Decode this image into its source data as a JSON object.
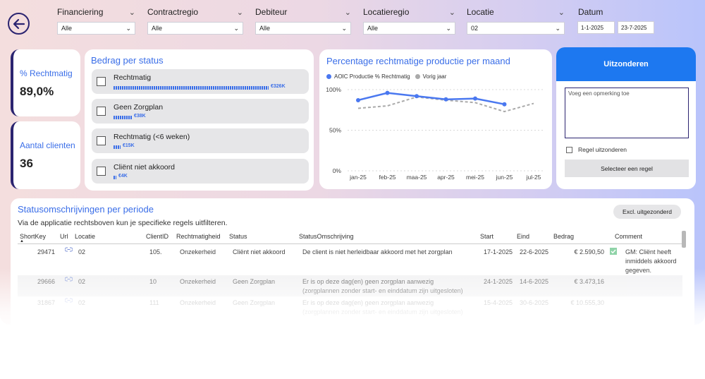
{
  "filters": [
    {
      "label": "Financiering",
      "value": "Alle"
    },
    {
      "label": "Contractregio",
      "value": "Alle"
    },
    {
      "label": "Debiteur",
      "value": "Alle"
    },
    {
      "label": "Locatieregio",
      "value": "Alle"
    },
    {
      "label": "Locatie",
      "value": "02"
    }
  ],
  "date": {
    "label": "Datum",
    "from": "1-1-2025",
    "to": "23-7-2025"
  },
  "kpis": {
    "rechtmatig": {
      "label": "% Rechtmatig",
      "value": "89,0%"
    },
    "clienten": {
      "label": "Aantal clienten",
      "value": "36"
    }
  },
  "status_card": {
    "title": "Bedrag per status",
    "items": [
      {
        "name": "Rechtmatig",
        "value": "€326K",
        "fraction": 1.0
      },
      {
        "name": "Geen Zorgplan",
        "value": "€38K",
        "fraction": 0.117
      },
      {
        "name": "Rechtmatig (<6 weken)",
        "value": "€15K",
        "fraction": 0.046
      },
      {
        "name": "Cliënt niet akkoord",
        "value": "€4K",
        "fraction": 0.012
      }
    ]
  },
  "chart_data": {
    "type": "line",
    "title": "Percentage rechtmatige productie per maand",
    "categories": [
      "jan-25",
      "feb-25",
      "maa-25",
      "apr-25",
      "mei-25",
      "jun-25",
      "jul-25"
    ],
    "series": [
      {
        "name": "AOIC Productie % Rechtmatig",
        "color": "#4a78f0",
        "values": [
          87,
          96,
          92,
          88,
          89,
          82,
          null
        ]
      },
      {
        "name": "Vorig jaar",
        "color": "#aaaaaa",
        "values": [
          77,
          80,
          91,
          87,
          84,
          73,
          83
        ]
      }
    ],
    "yticks": [
      "100%",
      "50%",
      "0%"
    ],
    "ylim": [
      0,
      100
    ],
    "grid": true,
    "legend": "top-left"
  },
  "uitzonderen": {
    "title": "Uitzonderen",
    "placeholder": "Voeg een opmerking toe",
    "checkbox_label": "Regel uitzonderen",
    "button_label": "Selecteer een regel"
  },
  "table": {
    "title": "Statusomschrijvingen per periode",
    "subtitle": "Via de applicatie rechtsboven kun je specifieke regels uitfilteren.",
    "excl_button": "Excl. uitgezonderd",
    "headers": [
      "ShortKey",
      "Url",
      "Locatie",
      "ClientID",
      "Rechtmatigheid",
      "Status",
      "StatusOmschrijving",
      "Start",
      "Eind",
      "Bedrag",
      "Comment"
    ],
    "rows": [
      {
        "shortkey": "29471",
        "locatie": "02",
        "clientid": "105.",
        "rechtmatigheid": "Onzekerheid",
        "status": "Cliënt niet akkoord",
        "omschrijving": "De client is niet herleidbaar akkoord met het zorgplan",
        "omschrijving2": "",
        "start": "17-1-2025",
        "eind": "22-6-2025",
        "bedrag": "€ 2.590,50",
        "comment": "GM: Cliënt heeft inmiddels akkoord gegeven."
      },
      {
        "shortkey": "29666",
        "locatie": "02",
        "clientid": "10",
        "rechtmatigheid": "Onzekerheid",
        "status": "Geen Zorgplan",
        "omschrijving": "Er is op deze dag(en) geen zorgplan aanwezig",
        "omschrijving2": "(zorgplannen zonder start- en einddatum zijn uitgesloten)",
        "start": "24-1-2025",
        "eind": "14-6-2025",
        "bedrag": "€ 3.473,16",
        "comment": ""
      },
      {
        "shortkey": "31867",
        "locatie": "02",
        "clientid": "111",
        "rechtmatigheid": "Onzekerheid",
        "status": "Geen Zorgplan",
        "omschrijving": "Er is op deze dag(en) geen zorgplan aanwezig",
        "omschrijving2": "(zorgplannen zonder start- en einddatum zijn uitgesloten)",
        "start": "15-4-2025",
        "eind": "30-6-2025",
        "bedrag": "€ 10.555,30",
        "comment": ""
      }
    ]
  }
}
